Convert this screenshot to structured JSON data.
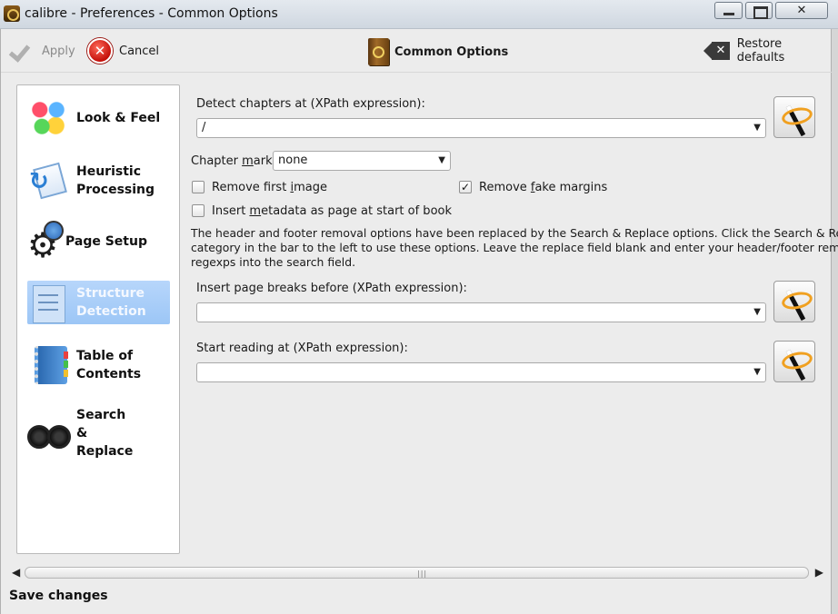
{
  "window": {
    "title": "calibre - Preferences - Common Options",
    "minimize_glyph": "",
    "maximize_glyph": "",
    "close_glyph": "✕"
  },
  "toolbar": {
    "apply_label": "Apply",
    "cancel_label": "Cancel",
    "title": "Common Options",
    "restore_label": "Restore defaults"
  },
  "sidebar": {
    "items": [
      {
        "label": "Look & Feel",
        "icon": "look-feel-icon"
      },
      {
        "label": "Heuristic Processing",
        "icon": "heuristic-icon"
      },
      {
        "label": "Page Setup",
        "icon": "page-setup-icon"
      },
      {
        "label": "Structure Detection",
        "icon": "structure-icon",
        "active": true
      },
      {
        "label": "Table of Contents",
        "icon": "toc-icon"
      },
      {
        "label": "Search & Replace",
        "icon": "binoculars-icon"
      }
    ]
  },
  "form": {
    "detect_chapters_label": "Detect chapters at (XPath expression):",
    "detect_chapters_value": "/",
    "chapter_mark_label_pre": "Chapter ",
    "chapter_mark_label_u": "m",
    "chapter_mark_label_post": "ark:",
    "chapter_mark_value": "none",
    "remove_first_image_pre": "Remove first ",
    "remove_first_image_u": "i",
    "remove_first_image_post": "mage",
    "remove_first_image_checked": false,
    "remove_fake_margins_pre": "Remove ",
    "remove_fake_margins_u": "f",
    "remove_fake_margins_post": "ake margins",
    "remove_fake_margins_checked": true,
    "insert_metadata_pre": "Insert ",
    "insert_metadata_u": "m",
    "insert_metadata_post": "etadata as page at start of book",
    "insert_metadata_checked": false,
    "info_line1": "The header and footer removal options have been replaced by the Search & Replace options. Click the Search & Replace",
    "info_line2": "category in the bar to the left to use these options. Leave the replace field blank and enter your header/footer removal",
    "info_line3": "regexps into the search field.",
    "page_breaks_label": "Insert page breaks before (XPath expression):",
    "page_breaks_value": "",
    "start_reading_label": "Start reading at (XPath expression):",
    "start_reading_value": "",
    "dropdown_arrow": "▼",
    "check_mark": "✓"
  },
  "scrollbar": {
    "left_arrow": "◀",
    "right_arrow": "▶",
    "grip": "|||"
  },
  "status": {
    "text": "Save changes"
  }
}
